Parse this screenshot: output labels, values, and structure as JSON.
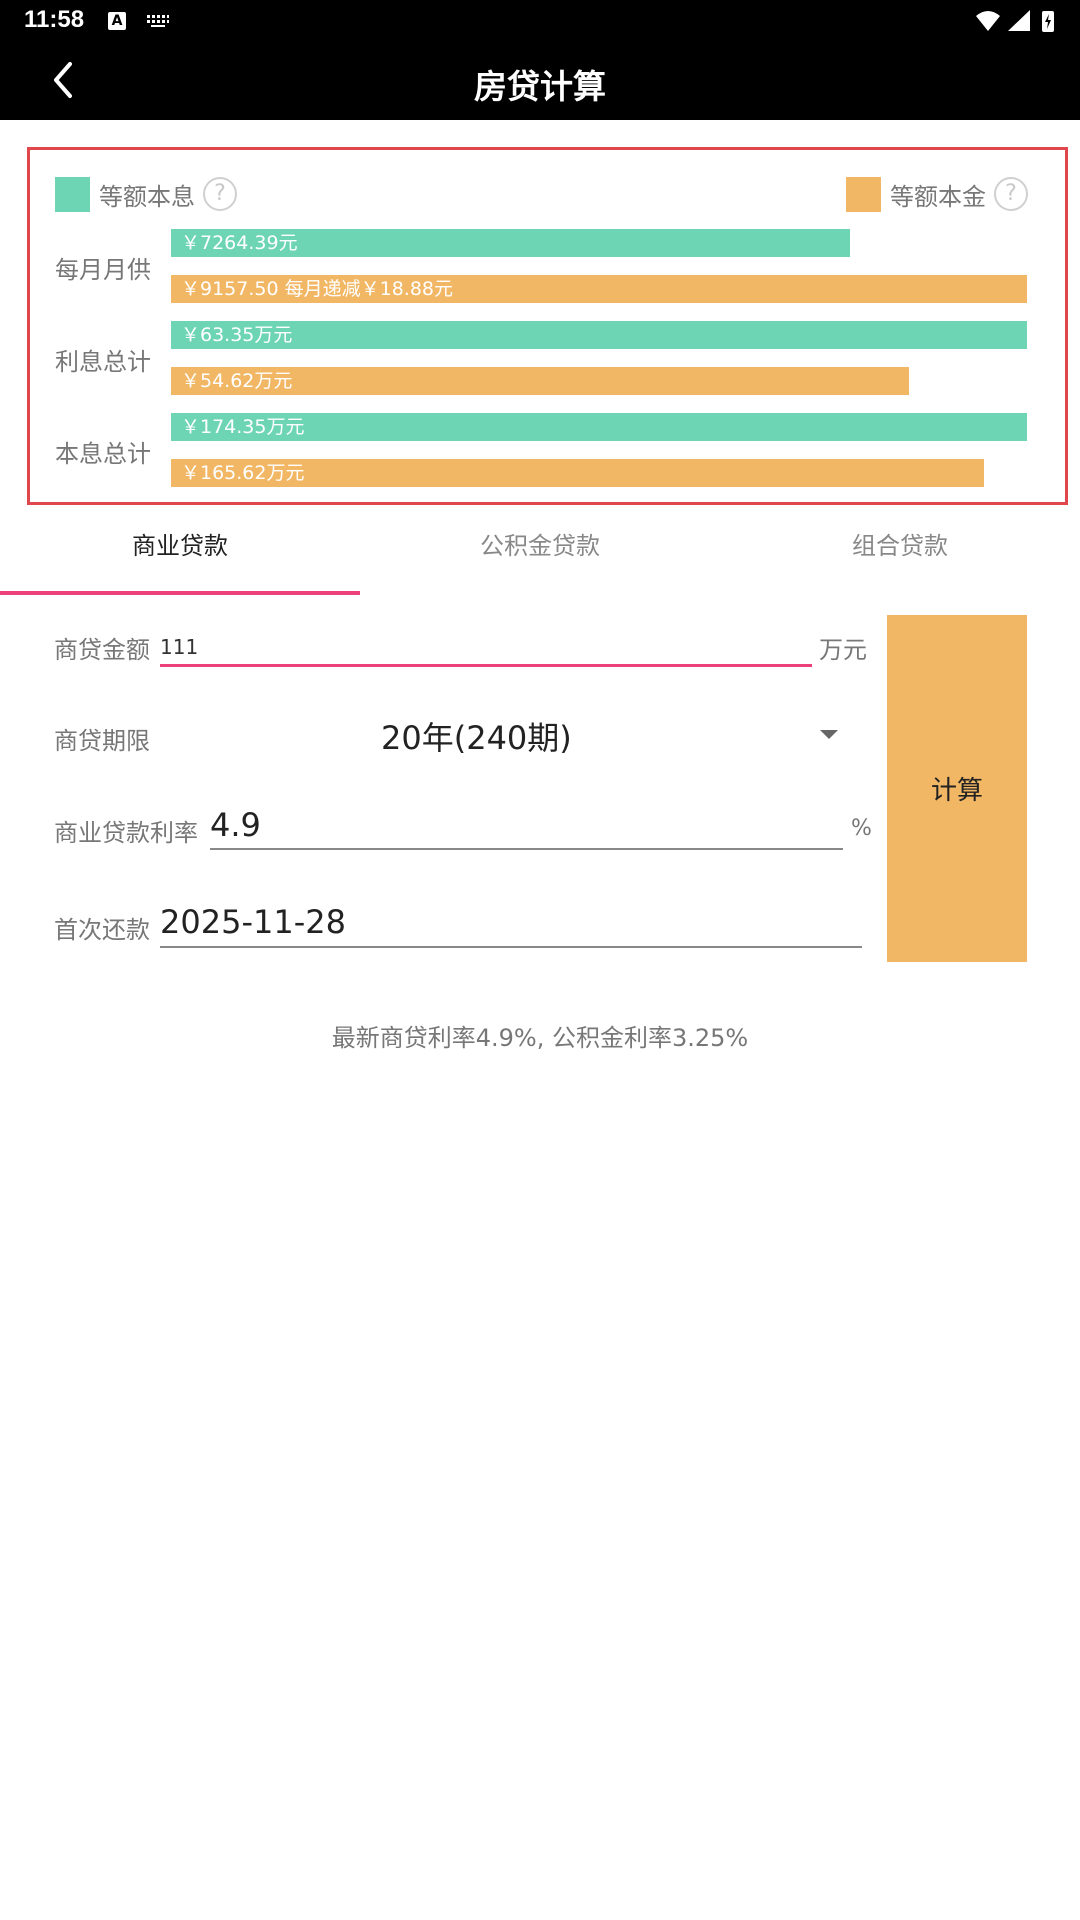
{
  "status_bar": {
    "time": "11:58",
    "notification_letter": "A"
  },
  "app_bar": {
    "title": "房贷计算"
  },
  "colors": {
    "equal_installment": "#6dd5b3",
    "equal_principal": "#f1b765",
    "accent": "#ec407a",
    "panel_border": "#e0474c"
  },
  "chart_data": {
    "type": "bar",
    "legend": [
      {
        "name": "等额本息",
        "color": "#6dd5b3",
        "help": "?"
      },
      {
        "name": "等额本金",
        "color": "#f1b765",
        "help": "?"
      }
    ],
    "categories": [
      "每月月供",
      "利息总计",
      "本息总计"
    ],
    "series": [
      {
        "name": "等额本息",
        "values": [
          7264.39,
          633500,
          1743500
        ],
        "labels": [
          "￥7264.39元",
          "￥63.35万元",
          "￥174.35万元"
        ]
      },
      {
        "name": "等额本金",
        "values": [
          9157.5,
          546200,
          1656200
        ],
        "labels": [
          "￥9157.50 每月递减￥18.88元",
          "￥54.62万元",
          "￥165.62万元"
        ]
      }
    ]
  },
  "tabs": [
    {
      "label": "商业贷款",
      "active": true
    },
    {
      "label": "公积金贷款",
      "active": false
    },
    {
      "label": "组合贷款",
      "active": false
    }
  ],
  "form": {
    "amount": {
      "label": "商贷金额",
      "value": "111",
      "unit": "万元"
    },
    "term": {
      "label": "商贷期限",
      "value": "20年(240期)"
    },
    "rate": {
      "label": "商业贷款利率",
      "value": "4.9",
      "unit": "%"
    },
    "first_payment": {
      "label": "首次还款",
      "value": "2025-11-28"
    },
    "calculate_label": "计算"
  },
  "rate_note": "最新商贷利率4.9%, 公积金利率3.25%"
}
